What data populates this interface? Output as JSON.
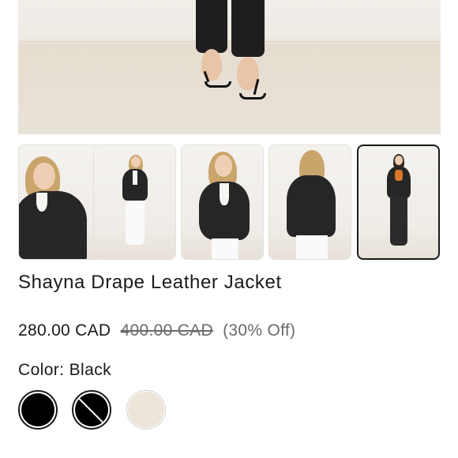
{
  "product": {
    "title": "Shayna Drape Leather Jacket",
    "price_current": "280.00 CAD",
    "price_original": "400.00 CAD",
    "price_discount": "(30% Off)"
  },
  "gallery": {
    "selected_index": 4,
    "thumbnails": [
      {
        "name": "thumbnail-1"
      },
      {
        "name": "thumbnail-2"
      },
      {
        "name": "thumbnail-3"
      },
      {
        "name": "thumbnail-4"
      },
      {
        "name": "thumbnail-5"
      }
    ]
  },
  "color": {
    "label": "Color: Black",
    "swatches": [
      {
        "color": "#000000",
        "selected": true,
        "available": true
      },
      {
        "color": "#000000",
        "selected": false,
        "available": false
      },
      {
        "color": "#ece6da",
        "selected": false,
        "available": true
      }
    ]
  },
  "colors": {
    "text": "#1a1a1a",
    "muted": "#6a6a6a",
    "selected_border": "#1a1a1a"
  }
}
